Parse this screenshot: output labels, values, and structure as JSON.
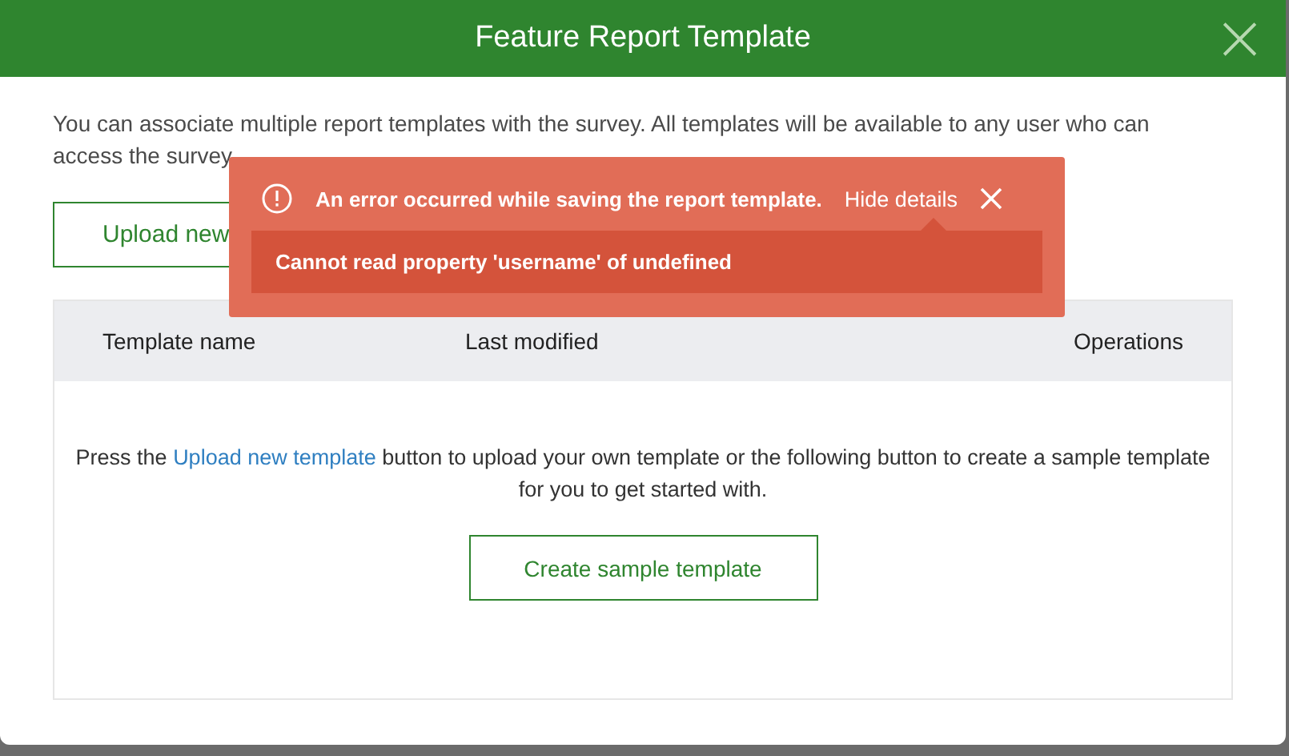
{
  "dialog": {
    "title": "Feature Report Template",
    "close_icon": "×"
  },
  "intro": "You can associate multiple report templates with the survey. All templates will be available to any user who can access the survey",
  "upload_button": "Upload new",
  "table": {
    "columns": [
      "Template name",
      "Last modified",
      "Operations"
    ],
    "empty_message": {
      "before": "Press the ",
      "link": "Upload new template",
      "after": " button to upload your own template or the following button to create a sample template for you to get started with."
    },
    "create_button": "Create sample template"
  },
  "toast": {
    "message": "An error occurred while saving the report template.",
    "toggle": "Hide details",
    "details_expanded": true,
    "details": "Cannot read property 'username' of undefined"
  }
}
